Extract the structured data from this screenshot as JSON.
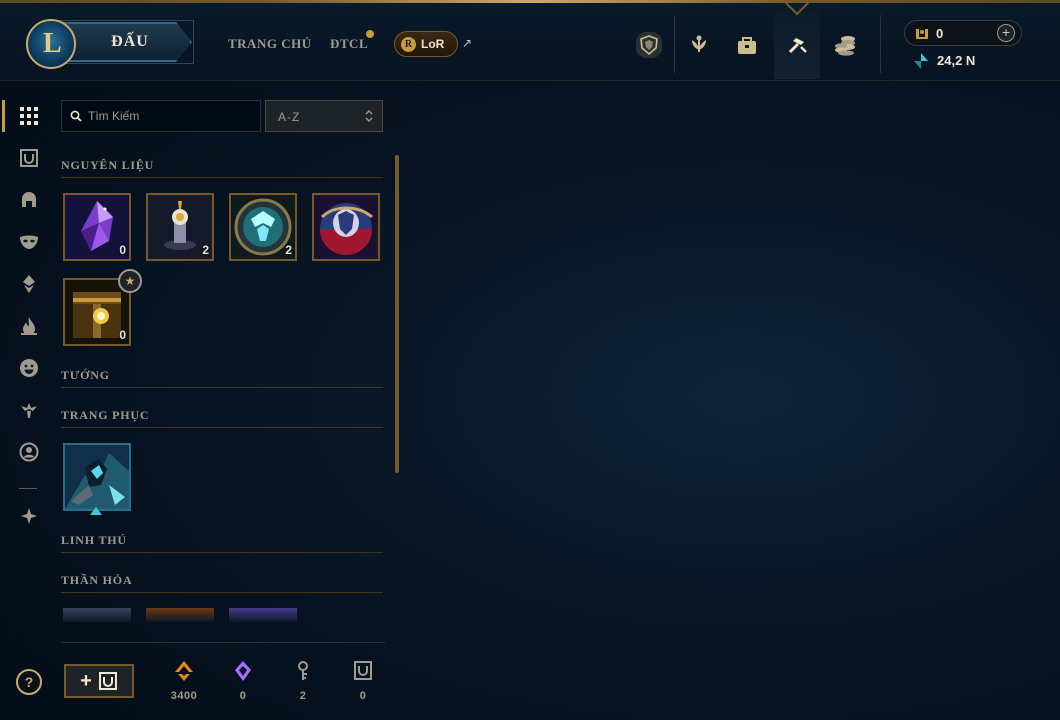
{
  "header": {
    "logo_letter": "L",
    "play_label": "ĐẤU",
    "nav": [
      {
        "label": "TRANG CHỦ"
      },
      {
        "label": "ĐTCL"
      }
    ],
    "lor_label": "LoR",
    "lor_glyph": "R",
    "external_arrow": "↗",
    "icons": [
      "tft-emblem-icon",
      "rank-laurel-icon",
      "collection-bag-icon",
      "loot-crafting-icon",
      "store-coins-icon"
    ],
    "riot_points": "0",
    "rp_plus": "+",
    "blue_essence": "24,2 N"
  },
  "sidebar": {
    "icons": [
      "grid-icon",
      "chest-icon",
      "helmet-icon",
      "mask-icon",
      "ward-icon",
      "flame-icon",
      "emote-icon",
      "companion-icon",
      "profile-icon",
      "eternals-icon"
    ],
    "help": "?"
  },
  "search": {
    "placeholder": "Tìm Kiếm"
  },
  "sort": {
    "value": "A-Z"
  },
  "sections": {
    "materials": "NGUYÊN LIỆU",
    "champions": "TƯỚNG",
    "skins": "TRANG PHỤC",
    "companions": "LINH THÚ",
    "ward_skins": "THẦN HỎA"
  },
  "materials": [
    {
      "name": "purple-gem-icon",
      "count": "0"
    },
    {
      "name": "potion-altar-icon",
      "count": "2"
    },
    {
      "name": "clash-emblem-icon",
      "count": "2"
    },
    {
      "name": "event-orb-icon",
      "count": ""
    },
    {
      "name": "hextech-chest-icon",
      "count": "0"
    }
  ],
  "footer": {
    "orange_essence": "3400",
    "mythic_essence": "0",
    "keys": "2",
    "chests": "0"
  },
  "colors": {
    "gold": "#c8aa6e",
    "gold_dark": "#785a28",
    "text_light": "#f0e6d2",
    "text_muted": "#a09b8c",
    "orange_essence": "#e8821e",
    "mythic": "#a86cff",
    "blue_essence": "#3cc8d8"
  }
}
